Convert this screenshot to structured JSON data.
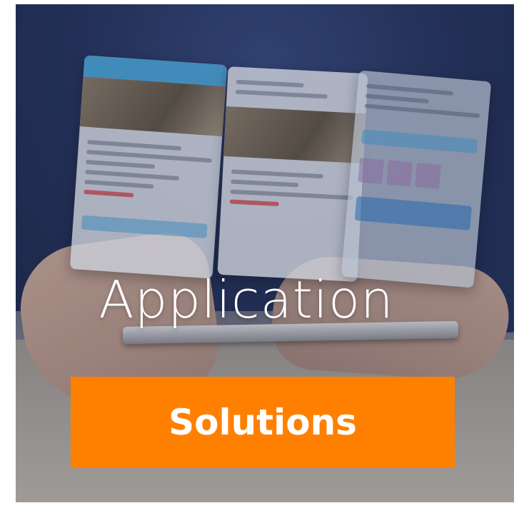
{
  "hero": {
    "headline": "Application",
    "cta_label": "Solutions",
    "colors": {
      "cta_background": "#ff8000",
      "text": "#ffffff"
    }
  }
}
